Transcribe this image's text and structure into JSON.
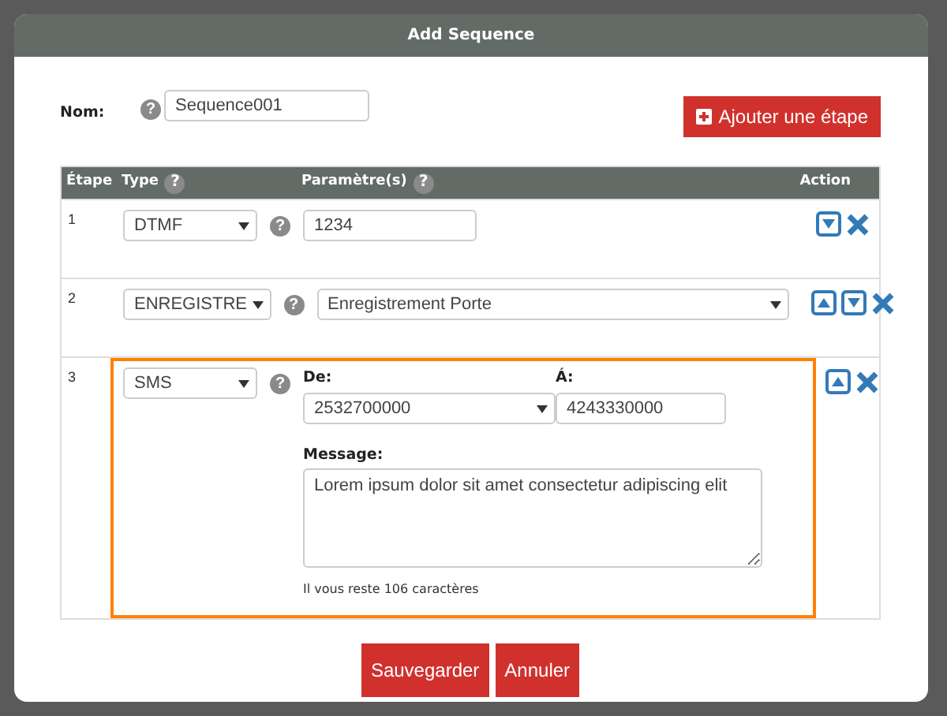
{
  "modal": {
    "title": "Add Sequence"
  },
  "name_field": {
    "label": "Nom:",
    "help": "?",
    "value": "Sequence001"
  },
  "add_button": {
    "label": "Ajouter une étape"
  },
  "table": {
    "columns": [
      {
        "label": "Étape"
      },
      {
        "label": "Type",
        "help": "?"
      },
      {
        "label": "Paramètre(s)",
        "help": "?"
      },
      {
        "label": "Action"
      }
    ],
    "rows": [
      {
        "step": "1",
        "kind": "text",
        "type": "DTMF",
        "help": "?",
        "value": "1234",
        "highlighted": false,
        "move_up": false,
        "move_down": true
      },
      {
        "step": "2",
        "kind": "select",
        "type": "ENREGISTRE",
        "help": "?",
        "value": "Enregistrement Porte",
        "highlighted": false,
        "move_up": true,
        "move_down": true
      },
      {
        "step": "3",
        "kind": "sms",
        "type": "SMS",
        "help": "?",
        "from_label": "De:",
        "from": "2532700000",
        "to_label": "Á:",
        "to": "4243330000",
        "message_label": "Message:",
        "message": "Lorem ipsum dolor sit amet consectetur adipiscing elit",
        "counter": "Il vous reste 106 caractères",
        "highlighted": true,
        "move_up": true,
        "move_down": false
      }
    ]
  },
  "footer_buttons": [
    {
      "label": "Sauvegarder"
    },
    {
      "label": "Annuler"
    }
  ]
}
